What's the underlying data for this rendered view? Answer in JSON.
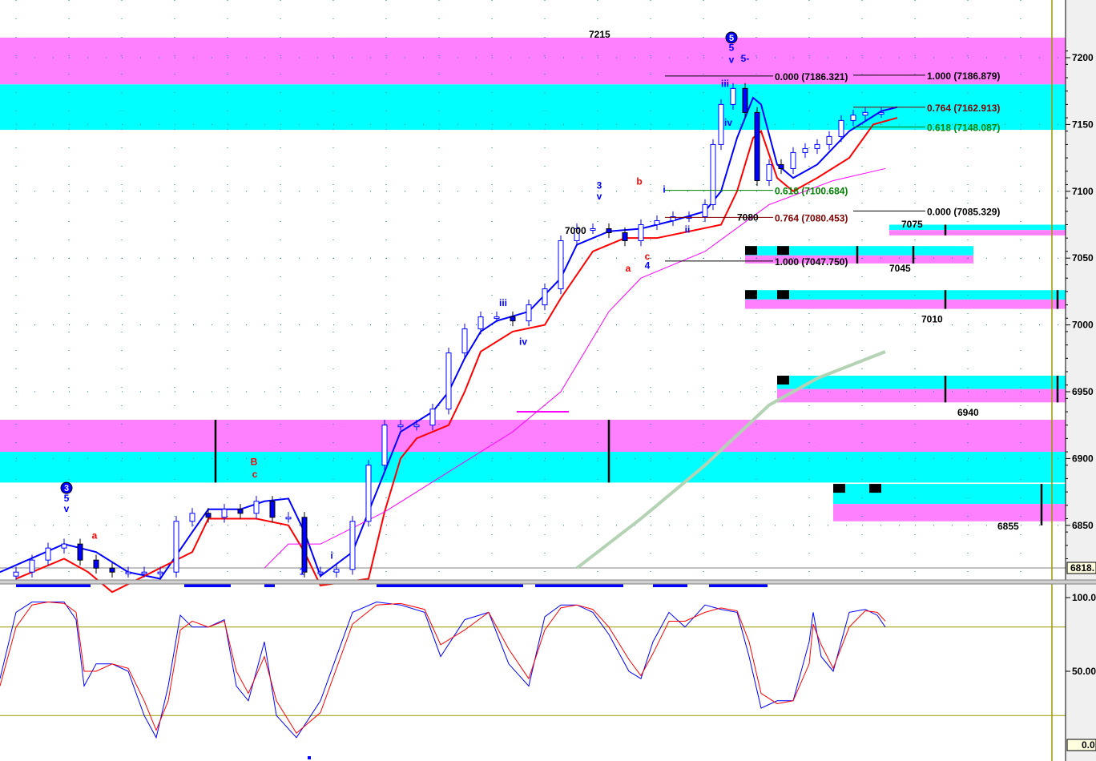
{
  "chart_data": {
    "type": "line",
    "title": "",
    "price_panel": {
      "ylim": [
        6818,
        7215
      ],
      "yticks": [
        "7200",
        "7150",
        "7100",
        "7050",
        "7000",
        "6950",
        "6900",
        "6850"
      ],
      "ytick_values": [
        7200,
        7150,
        7100,
        7050,
        7000,
        6950,
        6900,
        6850
      ],
      "last_price_label": "6818.",
      "close": {
        "x": [
          4,
          8,
          12,
          16,
          20,
          24,
          28,
          32,
          36,
          40,
          44,
          48,
          52,
          56,
          60,
          64,
          68,
          72,
          76,
          80,
          84,
          88,
          92,
          96,
          100,
          104,
          108,
          112,
          116,
          120,
          124,
          128,
          132,
          136,
          140,
          144,
          148,
          152,
          156,
          160,
          164,
          168,
          172,
          176,
          178,
          180,
          183,
          186,
          189,
          192,
          195,
          198,
          201,
          204,
          207,
          210,
          213,
          216,
          220
        ],
        "y": [
          6815,
          6824,
          6833,
          6836,
          6824,
          6818,
          6815,
          6815,
          6815,
          6815,
          6853,
          6859,
          6856,
          6862,
          6859,
          6868,
          6856,
          6856,
          6815,
          6815,
          6817,
          6853,
          6895,
          6925,
          6925,
          6925,
          6937,
          6979,
          6997,
          7006,
          7006,
          7003,
          7015,
          7027,
          7063,
          7072,
          7072,
          7069,
          7063,
          7075,
          7078,
          7081,
          7081,
          7090,
          7135,
          7165,
          7177,
          7159,
          7108,
          7120,
          7117,
          7129,
          7132,
          7135,
          7141,
          7153,
          7157,
          7159,
          7159
        ]
      },
      "series": [
        {
          "name": "upper-band",
          "color": "#0000ff",
          "x": [
            0,
            16,
            24,
            32,
            40,
            48,
            52,
            60,
            66,
            72,
            76,
            80,
            88,
            92,
            96,
            100,
            108,
            112,
            116,
            120,
            124,
            132,
            140,
            144,
            152,
            160,
            168,
            176,
            180,
            184,
            188,
            190,
            194,
            198,
            204,
            212,
            220,
            224
          ],
          "y": [
            6815,
            6836,
            6830,
            6815,
            6810,
            6845,
            6862,
            6862,
            6868,
            6870,
            6845,
            6812,
            6830,
            6860,
            6890,
            6920,
            6935,
            6950,
            6975,
            6995,
            7003,
            7010,
            7035,
            7060,
            7070,
            7072,
            7078,
            7085,
            7100,
            7140,
            7170,
            7165,
            7120,
            7110,
            7120,
            7145,
            7160,
            7163
          ]
        },
        {
          "name": "lower-band",
          "color": "#ff0000",
          "x": [
            4,
            16,
            22,
            28,
            48,
            52,
            64,
            72,
            76,
            80,
            92,
            96,
            100,
            104,
            112,
            116,
            120,
            128,
            136,
            140,
            148,
            156,
            164,
            172,
            180,
            184,
            188,
            190,
            194,
            198,
            204,
            212,
            218,
            224
          ],
          "y": [
            6810,
            6825,
            6815,
            6800,
            6830,
            6855,
            6855,
            6850,
            6830,
            6805,
            6810,
            6860,
            6900,
            6915,
            6925,
            6950,
            6980,
            6995,
            7000,
            7020,
            7055,
            7065,
            7065,
            7070,
            7075,
            7100,
            7140,
            7145,
            7110,
            7100,
            7110,
            7125,
            7150,
            7155
          ]
        },
        {
          "name": "moving-average",
          "color": "#ff00ff",
          "x": [
            66,
            72,
            80,
            96,
            112,
            128,
            140,
            152,
            160,
            176,
            192,
            208,
            221
          ],
          "y": [
            6818,
            6836,
            6836,
            6860,
            6890,
            6920,
            6950,
            7010,
            7035,
            7055,
            7090,
            7108,
            7117
          ]
        },
        {
          "name": "trend-line",
          "color": "#b4d2b4",
          "x": [
            144,
            160,
            176,
            192,
            204,
            221
          ],
          "y": [
            6818,
            6855,
            6895,
            6940,
            6960,
            6980
          ]
        }
      ],
      "zones": [
        {
          "from": 7180,
          "to": 7215,
          "color": "#ff80ff",
          "x0": 0,
          "x1": 266
        },
        {
          "from": 7146,
          "to": 7180,
          "color": "#00ffff",
          "x0": 0,
          "x1": 266
        },
        {
          "from": 6905,
          "to": 6929,
          "color": "#ff80ff",
          "x0": 0,
          "x1": 266
        },
        {
          "from": 6882,
          "to": 6905,
          "color": "#00ffff",
          "x0": 0,
          "x1": 266
        },
        {
          "from": 7071,
          "to": 7075,
          "color": "#00ffff",
          "x0": 222,
          "x1": 266
        },
        {
          "from": 7067,
          "to": 7071,
          "color": "#ff80ff",
          "x0": 222,
          "x1": 266
        },
        {
          "from": 7052,
          "to": 7059,
          "color": "#00ffff",
          "x0": 186,
          "x1": 243
        },
        {
          "from": 7046,
          "to": 7052,
          "color": "#ff80ff",
          "x0": 186,
          "x1": 243
        },
        {
          "from": 7019,
          "to": 7026,
          "color": "#00ffff",
          "x0": 186,
          "x1": 266
        },
        {
          "from": 7012,
          "to": 7019,
          "color": "#ff80ff",
          "x0": 186,
          "x1": 266
        },
        {
          "from": 6952,
          "to": 6962,
          "color": "#00ffff",
          "x0": 194,
          "x1": 266
        },
        {
          "from": 6942,
          "to": 6952,
          "color": "#ff80ff",
          "x0": 194,
          "x1": 266
        },
        {
          "from": 6866,
          "to": 6881,
          "color": "#00ffff",
          "x0": 208,
          "x1": 266
        },
        {
          "from": 6853,
          "to": 6866,
          "color": "#ff80ff",
          "x0": 208,
          "x1": 266
        }
      ],
      "zone_labels": [
        {
          "text": "7215",
          "x": 147,
          "y": 7218
        },
        {
          "text": "7075",
          "x": 225,
          "y": 7076
        },
        {
          "text": "7045",
          "x": 222,
          "y": 7043
        },
        {
          "text": "7010",
          "x": 230,
          "y": 7005
        },
        {
          "text": "6940",
          "x": 239,
          "y": 6935
        },
        {
          "text": "6855",
          "x": 249,
          "y": 6850
        },
        {
          "text": "7080",
          "x": 184,
          "y": 7081
        },
        {
          "text": "7000",
          "x": 141,
          "y": 7071
        }
      ],
      "fib_levels": [
        {
          "text": "0.000 (7186.321)",
          "color": "#000000",
          "x0": 166,
          "x1": 193,
          "price": 7186.3
        },
        {
          "text": "1.000 (7186.879)",
          "color": "#000000",
          "x0": 213,
          "x1": 231,
          "price": 7186.9
        },
        {
          "text": "0.764 (7162.913)",
          "color": "#800000",
          "x0": 213,
          "x1": 231,
          "price": 7162.9
        },
        {
          "text": "0.618 (7148.087)",
          "color": "#008000",
          "x0": 213,
          "x1": 231,
          "price": 7148.1
        },
        {
          "text": "0.618 (7100.684)",
          "color": "#008000",
          "x0": 166,
          "x1": 193,
          "price": 7100.7
        },
        {
          "text": "0.000 (7085.329)",
          "color": "#000000",
          "x0": 213,
          "x1": 231,
          "price": 7085.3
        },
        {
          "text": "0.764 (7080.453)",
          "color": "#800000",
          "x0": 166,
          "x1": 193,
          "price": 7080.5
        },
        {
          "text": "1.000 (7047.750)",
          "color": "#000000",
          "x0": 166,
          "x1": 193,
          "price": 7047.8
        }
      ],
      "wave_labels": [
        {
          "text": "5",
          "color": "#0000ff",
          "x": 16.6,
          "y": 6868
        },
        {
          "text": "v",
          "color": "#0000ff",
          "x": 16.6,
          "y": 6860
        },
        {
          "text": "a",
          "color": "#ff0000",
          "x": 23.6,
          "y": 6840
        },
        {
          "text": "B",
          "color": "#ff0000",
          "x": 63.4,
          "y": 6895
        },
        {
          "text": "c",
          "color": "#ff0000",
          "x": 63.6,
          "y": 6886
        },
        {
          "text": "1",
          "color": "#0000ff",
          "x": 75.4,
          "y": 6813
        },
        {
          "text": "i",
          "color": "#0000ff",
          "x": 82.8,
          "y": 6825
        },
        {
          "text": "iii",
          "color": "#0000ff",
          "x": 125.6,
          "y": 7014
        },
        {
          "text": "iv",
          "color": "#0000ff",
          "x": 130.6,
          "y": 6985
        },
        {
          "text": "3",
          "color": "#0000ff",
          "x": 149.6,
          "y": 7102
        },
        {
          "text": "v",
          "color": "#0000ff",
          "x": 149.6,
          "y": 7094
        },
        {
          "text": "b",
          "color": "#ff0000",
          "x": 159.6,
          "y": 7105
        },
        {
          "text": "a",
          "color": "#ff0000",
          "x": 156.8,
          "y": 7040
        },
        {
          "text": "c",
          "color": "#ff0000",
          "x": 161.6,
          "y": 7049
        },
        {
          "text": "4",
          "color": "#0000ff",
          "x": 161.6,
          "y": 7042
        },
        {
          "text": "i",
          "color": "#0000ff",
          "x": 165.8,
          "y": 7099
        },
        {
          "text": "ii",
          "color": "#0000ff",
          "x": 171.6,
          "y": 7069
        },
        {
          "text": "iii",
          "color": "#0000ff",
          "x": 181,
          "y": 7178
        },
        {
          "text": "iv",
          "color": "#0000ff",
          "x": 181.8,
          "y": 7149
        },
        {
          "text": "5",
          "color": "#0000ff",
          "x": 182.6,
          "y": 7205
        },
        {
          "text": "v",
          "color": "#0000ff",
          "x": 182.6,
          "y": 7196
        },
        {
          "text": "5-",
          "color": "#0000ff",
          "x": 186,
          "y": 7197
        }
      ],
      "circle_labels": [
        {
          "text": "3",
          "x": 16.6,
          "y": 6878
        },
        {
          "text": "5",
          "x": 182.6,
          "y": 7215
        }
      ]
    },
    "oscillator_panel": {
      "ylim": [
        0,
        100
      ],
      "yticks": [
        "100.0",
        "50.00"
      ],
      "ytick_values": [
        100,
        50
      ],
      "zero_label": "0.0",
      "levels": [
        80,
        20
      ],
      "signal_bars": [
        [
          4,
          22.6
        ],
        [
          46,
          57.6
        ],
        [
          66,
          68.6
        ],
        [
          94,
          130.6
        ],
        [
          133.6,
          155.6
        ],
        [
          163,
          171.6
        ],
        [
          177,
          191.6
        ]
      ],
      "series": [
        {
          "name": "%K",
          "color": "#0000ff",
          "x": [
            0,
            4,
            8,
            12,
            16,
            19,
            21,
            24,
            28,
            32,
            36,
            39,
            42,
            45,
            48,
            52,
            56,
            59,
            62,
            66,
            69,
            74,
            80,
            88,
            94,
            100,
            106,
            110,
            116,
            122,
            127,
            132,
            136,
            140,
            144,
            148,
            152,
            157,
            160,
            163,
            167,
            171,
            176,
            180,
            184,
            187,
            190,
            194,
            198,
            202,
            203,
            205,
            208,
            212,
            216,
            219,
            221
          ],
          "y": [
            45,
            90,
            97,
            97,
            97,
            85,
            40,
            55,
            55,
            50,
            20,
            5,
            40,
            88,
            80,
            80,
            85,
            40,
            30,
            70,
            20,
            5,
            30,
            90,
            97,
            95,
            90,
            60,
            85,
            90,
            55,
            40,
            87,
            95,
            95,
            90,
            75,
            50,
            45,
            70,
            90,
            80,
            95,
            92,
            90,
            60,
            25,
            30,
            30,
            70,
            90,
            60,
            50,
            90,
            92,
            88,
            80
          ]
        },
        {
          "name": "%D",
          "color": "#ff0000",
          "x": [
            0,
            4,
            8,
            12,
            16,
            19,
            21,
            24,
            28,
            32,
            36,
            39,
            42,
            45,
            48,
            52,
            56,
            59,
            62,
            66,
            69,
            74,
            80,
            88,
            94,
            100,
            106,
            110,
            116,
            122,
            127,
            132,
            136,
            140,
            144,
            148,
            152,
            157,
            160,
            163,
            167,
            171,
            176,
            180,
            184,
            187,
            190,
            194,
            198,
            202,
            203,
            205,
            208,
            212,
            216,
            219,
            221
          ],
          "y": [
            40,
            80,
            95,
            97,
            96,
            90,
            50,
            50,
            55,
            52,
            30,
            10,
            30,
            78,
            84,
            80,
            84,
            50,
            35,
            60,
            30,
            8,
            22,
            82,
            95,
            96,
            92,
            68,
            78,
            90,
            65,
            45,
            78,
            93,
            95,
            92,
            80,
            58,
            47,
            62,
            84,
            84,
            90,
            93,
            91,
            70,
            35,
            28,
            30,
            55,
            82,
            68,
            52,
            80,
            91,
            90,
            84
          ]
        }
      ]
    }
  }
}
